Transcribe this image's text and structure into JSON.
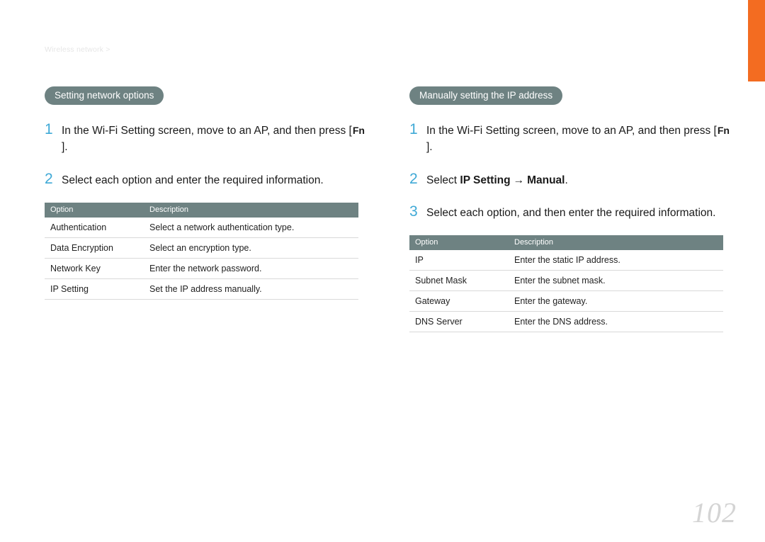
{
  "breadcrumb": "Wireless network >",
  "left": {
    "pill": "Setting network options",
    "steps": [
      {
        "num": "1",
        "pre": "In the Wi-Fi Setting screen, move to an AP, and then press [",
        "key": "Fn",
        "post": "]."
      },
      {
        "num": "2",
        "text": "Select each option and enter the required information."
      }
    ],
    "table": {
      "headers": [
        "Option",
        "Description"
      ],
      "rows": [
        [
          "Authentication",
          "Select a network authentication type."
        ],
        [
          "Data Encryption",
          "Select an encryption type."
        ],
        [
          "Network Key",
          "Enter the network password."
        ],
        [
          "IP Setting",
          "Set the IP address manually."
        ]
      ]
    }
  },
  "right": {
    "pill": "Manually setting the IP address",
    "steps": [
      {
        "num": "1",
        "pre": "In the Wi-Fi Setting screen, move to an AP, and then press [",
        "key": "Fn",
        "post": "]."
      },
      {
        "num": "2",
        "select_pre": "Select ",
        "bold1": "IP Setting",
        "arrow": "→",
        "bold2": "Manual",
        "select_post": "."
      },
      {
        "num": "3",
        "text": "Select each option, and then enter the required information."
      }
    ],
    "table": {
      "headers": [
        "Option",
        "Description"
      ],
      "rows": [
        [
          "IP",
          "Enter the static IP address."
        ],
        [
          "Subnet Mask",
          "Enter the subnet mask."
        ],
        [
          "Gateway",
          "Enter the gateway."
        ],
        [
          "DNS Server",
          "Enter the DNS address."
        ]
      ]
    }
  },
  "page_num": "102"
}
